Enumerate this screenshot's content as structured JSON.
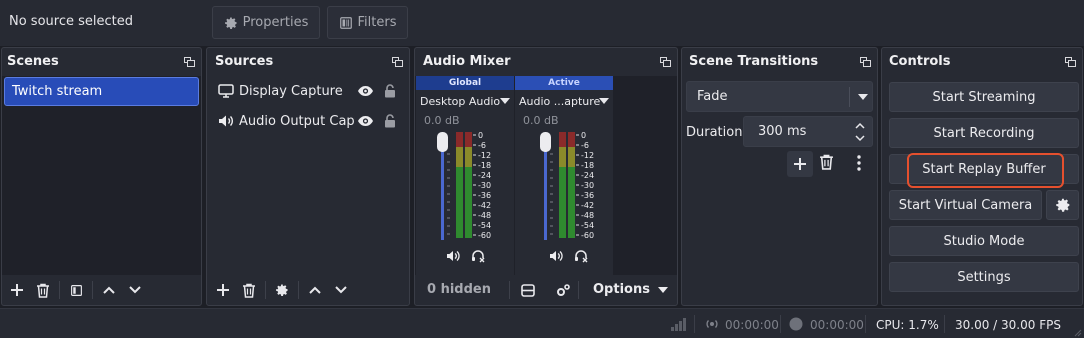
{
  "topbar": {
    "source_label": "No source selected",
    "properties_label": "Properties",
    "filters_label": "Filters"
  },
  "scenes": {
    "title": "Scenes",
    "items": [
      "Twitch stream"
    ]
  },
  "sources": {
    "title": "Sources",
    "items": [
      {
        "label": "Display Capture",
        "icon": "monitor-icon"
      },
      {
        "label": "Audio Output Capt",
        "icon": "speaker-icon"
      }
    ]
  },
  "mixer": {
    "title": "Audio Mixer",
    "channels": [
      {
        "group": "Global",
        "name": "Desktop Audio",
        "db": "0.0 dB"
      },
      {
        "group": "Active",
        "name": "Audio ...apture",
        "db": "0.0 dB"
      }
    ],
    "scale": [
      "0",
      "-6",
      "-12",
      "-18",
      "-24",
      "-30",
      "-36",
      "-42",
      "-48",
      "-54",
      "-60"
    ],
    "hidden_label": "0 hidden",
    "options_label": "Options"
  },
  "transitions": {
    "title": "Scene Transitions",
    "selected": "Fade",
    "duration_label": "Duration",
    "duration_value": "300 ms"
  },
  "controls": {
    "title": "Controls",
    "start_streaming": "Start Streaming",
    "start_recording": "Start Recording",
    "start_replay_buffer": "Start Replay Buffer",
    "start_virtual_camera": "Start Virtual Camera",
    "studio_mode": "Studio Mode",
    "settings": "Settings"
  },
  "status": {
    "stream_time": "00:00:00",
    "record_time": "00:00:00",
    "cpu": "CPU: 1.7%",
    "fps": "30.00 / 30.00 FPS"
  },
  "colors": {
    "accent": "#284cb8",
    "highlight": "#e5502e",
    "meter_green": "#2f8a2f",
    "meter_yellow": "#8a8a2a",
    "meter_red": "#8a2a2a"
  }
}
